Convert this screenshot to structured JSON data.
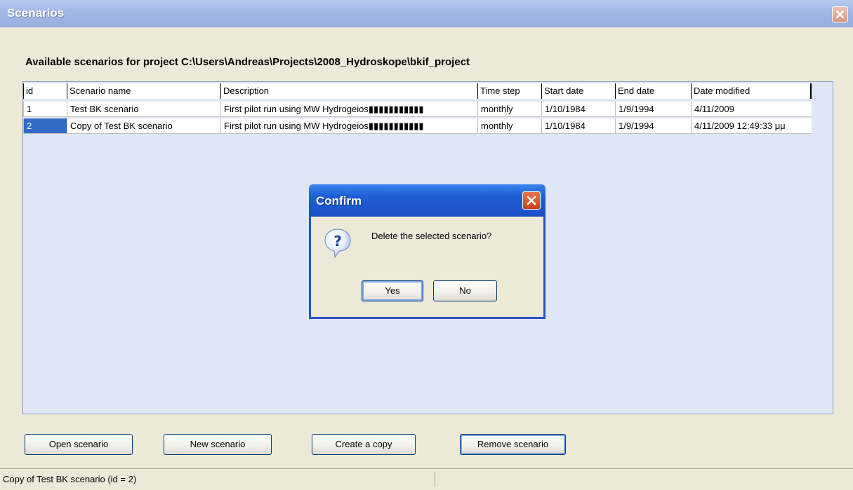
{
  "window": {
    "title": "Scenarios"
  },
  "heading": "Available scenarios for project C:\\Users\\Andreas\\Projects\\2008_Hydroskope\\bkif_project",
  "grid": {
    "columns": [
      "id",
      "Scenario name",
      "Description",
      "Time step",
      "Start date",
      "End date",
      "Date modified"
    ],
    "rows": [
      [
        "1",
        "Test BK scenario",
        "First pilot run using MW Hydrogeios▮▮▮▮▮▮▮▮▮▮▮",
        "monthly",
        "1/10/1984",
        "1/9/1994",
        "4/11/2009"
      ],
      [
        "2",
        "Copy of Test BK scenario",
        "First pilot run using MW Hydrogeios▮▮▮▮▮▮▮▮▮▮▮",
        "monthly",
        "1/10/1984",
        "1/9/1994",
        "4/11/2009 12:49:33 μμ"
      ]
    ],
    "selected_row": 1
  },
  "dialog": {
    "title": "Confirm",
    "message": "Delete the selected scenario?",
    "yes_label": "Yes",
    "no_label": "No"
  },
  "buttons": {
    "open": "Open scenario",
    "new": "New scenario",
    "copy": "Create a copy",
    "remove": "Remove scenario"
  },
  "status": {
    "text": "Copy of Test BK scenario (id = 2)"
  }
}
